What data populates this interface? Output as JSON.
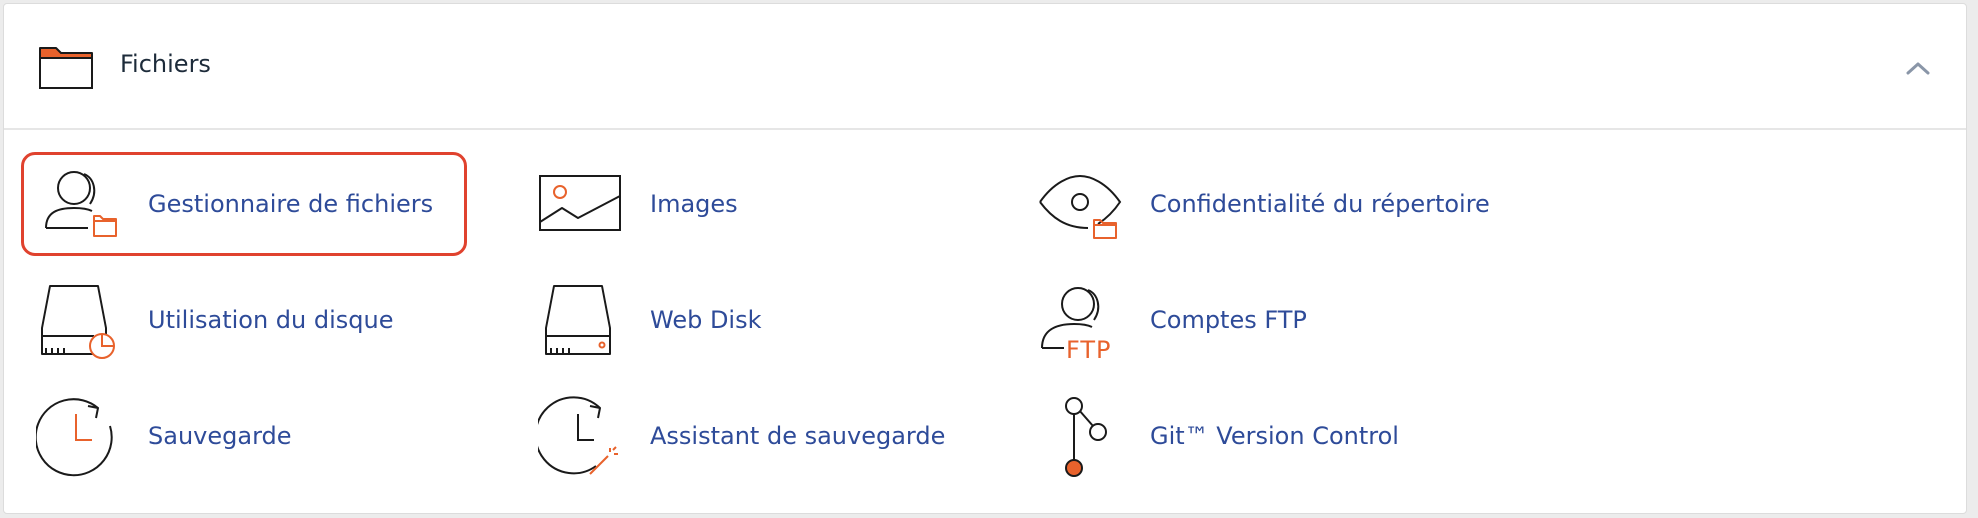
{
  "section": {
    "title": "Fichiers",
    "icon": "folder-icon",
    "collapse_icon": "chevron-up-icon"
  },
  "items": [
    {
      "label": "Gestionnaire de fichiers",
      "icon": "file-manager-icon",
      "selected": true
    },
    {
      "label": "Images",
      "icon": "images-icon"
    },
    {
      "label": "Confidentialité du répertoire",
      "icon": "directory-privacy-icon"
    },
    {
      "label": "Utilisation du disque",
      "icon": "disk-usage-icon"
    },
    {
      "label": "Web Disk",
      "icon": "web-disk-icon"
    },
    {
      "label": "Comptes FTP",
      "icon": "ftp-accounts-icon",
      "icon_text": "FTP"
    },
    {
      "label": "Sauvegarde",
      "icon": "backup-icon"
    },
    {
      "label": "Assistant de sauvegarde",
      "icon": "backup-wizard-icon"
    },
    {
      "label": "Git™ Version Control",
      "icon": "git-version-control-icon"
    }
  ],
  "colors": {
    "accent_orange": "#e8622c",
    "link_blue": "#2e4b99",
    "selection_red": "#e0422e",
    "icon_stroke": "#1a1a1a"
  }
}
